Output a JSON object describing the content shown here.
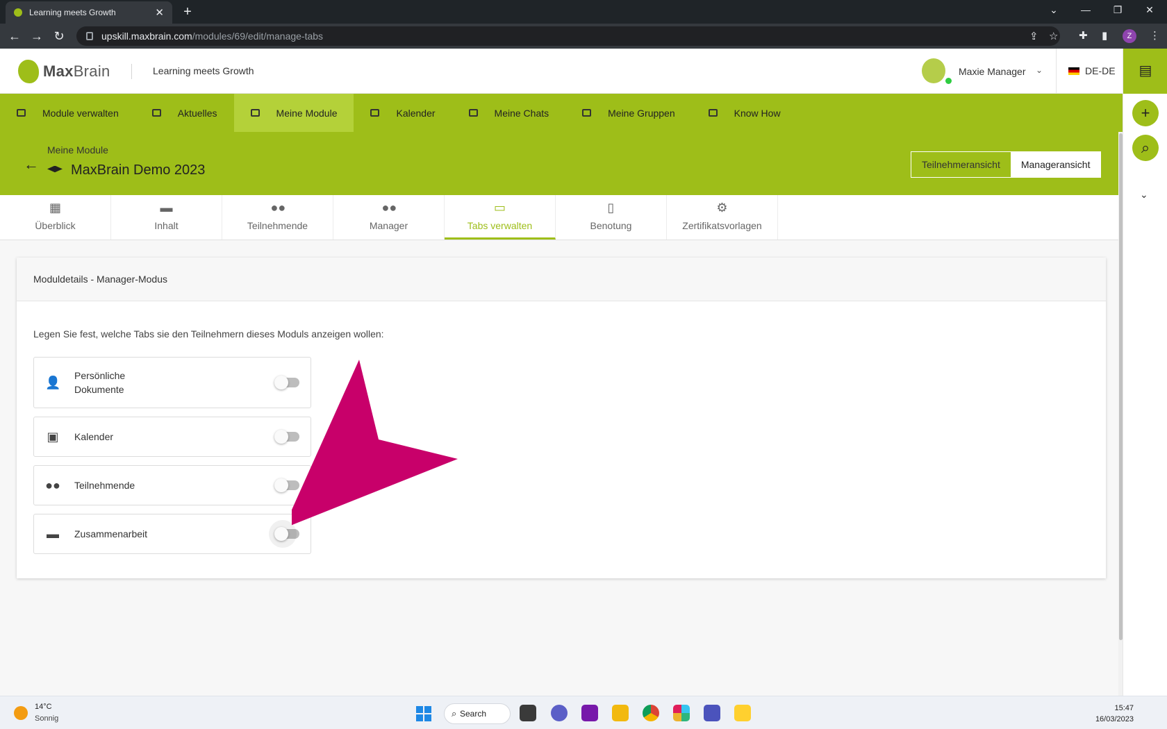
{
  "browser": {
    "tab_title": "Learning meets Growth",
    "url_host": "upskill.maxbrain.com",
    "url_path": "/modules/69/edit/manage-tabs",
    "profile_initial": "Z"
  },
  "header": {
    "logo_bold": "Max",
    "logo_light": "Brain",
    "tagline": "Learning meets Growth",
    "user_name": "Maxie Manager",
    "language": "DE-DE"
  },
  "main_nav": [
    {
      "label": "Module verwalten",
      "icon": "module-manage-icon"
    },
    {
      "label": "Aktuelles",
      "icon": "news-icon"
    },
    {
      "label": "Meine Module",
      "icon": "graduation-cap-icon",
      "active": true
    },
    {
      "label": "Kalender",
      "icon": "calendar-icon"
    },
    {
      "label": "Meine Chats",
      "icon": "chat-icon"
    },
    {
      "label": "Meine Gruppen",
      "icon": "groups-icon"
    },
    {
      "label": "Know How",
      "icon": "book-icon"
    }
  ],
  "module_header": {
    "breadcrumb": "Meine Module",
    "title": "MaxBrain Demo 2023",
    "view_participant": "Teilnehmeransicht",
    "view_manager": "Manageransicht"
  },
  "sub_tabs": [
    {
      "label": "Überblick",
      "icon": "dashboard-icon"
    },
    {
      "label": "Inhalt",
      "icon": "folder-icon"
    },
    {
      "label": "Teilnehmende",
      "icon": "people-icon"
    },
    {
      "label": "Manager",
      "icon": "manager-icon"
    },
    {
      "label": "Tabs verwalten",
      "icon": "tabs-icon",
      "active": true
    },
    {
      "label": "Benotung",
      "icon": "grade-document-icon"
    },
    {
      "label": "Zertifikatsvorlagen",
      "icon": "certificate-settings-icon"
    }
  ],
  "card": {
    "title": "Moduldetails - Manager-Modus",
    "description": "Legen Sie fest, welche Tabs sie den Teilnehmern dieses Moduls anzeigen wollen:",
    "toggles": [
      {
        "label": "Persönliche Dokumente",
        "icon": "personal-documents-icon",
        "enabled": false
      },
      {
        "label": "Kalender",
        "icon": "calendar-icon",
        "enabled": false
      },
      {
        "label": "Teilnehmende",
        "icon": "people-icon",
        "enabled": false
      },
      {
        "label": "Zusammenarbeit",
        "icon": "shared-folder-icon",
        "enabled": false
      }
    ]
  },
  "taskbar": {
    "temperature": "14°C",
    "weather": "Sonnig",
    "search_label": "Search",
    "time": "15:47",
    "date": "16/03/2023"
  },
  "colors": {
    "brand_green": "#9ebe19",
    "active_nav": "#b4d139",
    "annotation_arrow": "#c8006a"
  }
}
